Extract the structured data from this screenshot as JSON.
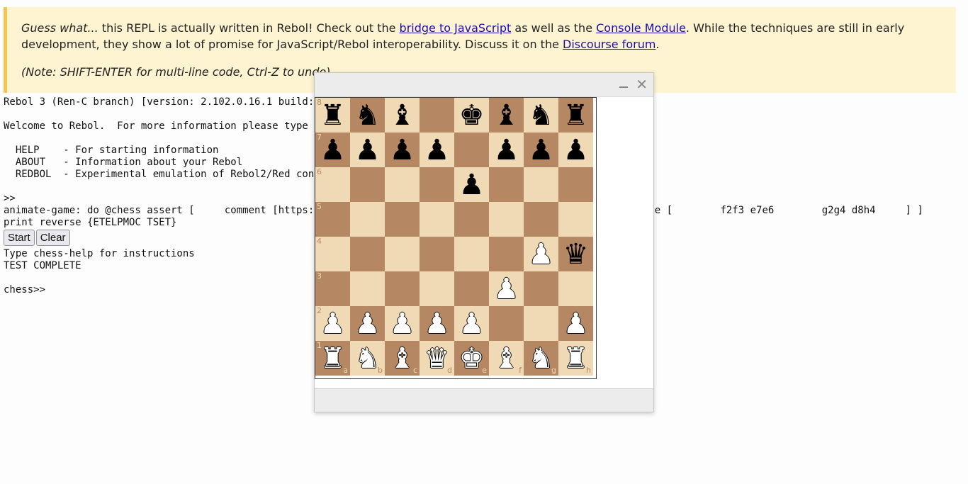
{
  "banner": {
    "guess_label": "Guess what...",
    "text1": " this REPL is actually written in Rebol! Check out the ",
    "link1": "bridge to JavaScript",
    "text2": " as well as the ",
    "link2": "Console Module",
    "text3": ". While the techniques are still in early development, they show a lot of promise for JavaScript/Rebol interoperability. Discuss it on the ",
    "link3": "Discourse forum",
    "text4": ".",
    "note": "(Note: SHIFT-ENTER for multi-line code, Ctrl-Z to undo)"
  },
  "console": {
    "line_version": "Rebol 3 (Ren-C branch) [version: 2.102.0.16.1 build:",
    "line_welcome": "Welcome to Rebol.  For more information please type i",
    "line_help": "  HELP    - For starting information",
    "line_about": "  ABOUT   - Information about your Rebol",
    "line_redbol": "  REDBOL  - Experimental emulation of Rebol2/Red conv",
    "prompt1": ">>",
    "line_animate": "animate-game: do @chess assert [     comment [https://e                                                     ne [        f2f3 e7e6        g2g4 d8h4     ] ]",
    "line_print": "print reverse {ETELPMOC TSET}",
    "start_button": "Start",
    "clear_button": "Clear",
    "line_type_help": "Type chess-help for instructions",
    "line_complete": "TEST COMPLETE",
    "prompt_chess": "chess>>"
  },
  "dialog": {
    "minimize_label": "–",
    "close_label": "✕"
  },
  "chess": {
    "ranks": [
      "8",
      "7",
      "6",
      "5",
      "4",
      "3",
      "2",
      "1"
    ],
    "files": [
      "a",
      "b",
      "c",
      "d",
      "e",
      "f",
      "g",
      "h"
    ],
    "board": [
      [
        "bR",
        "bN",
        "bB",
        "",
        "bK",
        "bB",
        "bN",
        "bR"
      ],
      [
        "bP",
        "bP",
        "bP",
        "bP",
        "",
        "bP",
        "bP",
        "bP"
      ],
      [
        "",
        "",
        "",
        "",
        "bP",
        "",
        "",
        ""
      ],
      [
        "",
        "",
        "",
        "",
        "",
        "",
        "",
        ""
      ],
      [
        "",
        "",
        "",
        "",
        "",
        "",
        "wP",
        "bQ"
      ],
      [
        "",
        "",
        "",
        "",
        "",
        "wP",
        "",
        ""
      ],
      [
        "wP",
        "wP",
        "wP",
        "wP",
        "wP",
        "",
        "",
        "wP"
      ],
      [
        "wR",
        "wN",
        "wB",
        "wQ",
        "wK",
        "wB",
        "wN",
        "wR"
      ]
    ]
  }
}
